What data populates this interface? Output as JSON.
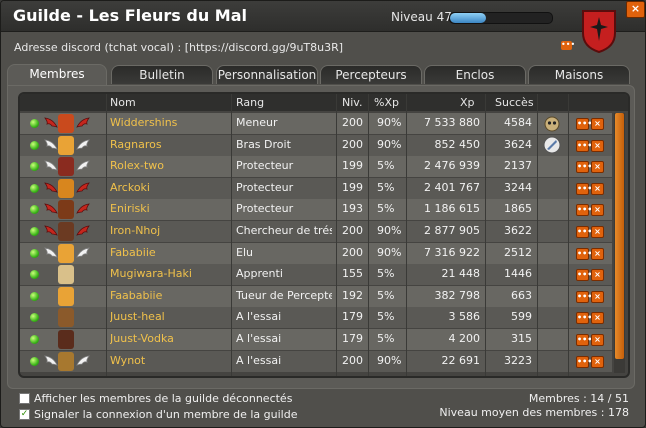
{
  "window": {
    "title": "Guilde - Les Fleurs du Mal",
    "level_label": "Niveau 47",
    "level_progress": 0.35,
    "close": "×"
  },
  "discord": {
    "text": "Adresse discord (tchat vocal) : [https://discord.gg/9uT8u3R]",
    "btn": "•••"
  },
  "tabs": [
    "Membres",
    "Bulletin",
    "Personnalisation",
    "Percepteurs",
    "Enclos",
    "Maisons"
  ],
  "columns": {
    "nom": "Nom",
    "rang": "Rang",
    "niv": "Niv.",
    "xpp": "%Xp",
    "xp": "Xp",
    "succes": "Succès"
  },
  "members": [
    {
      "nom": "Widdershins",
      "rang": "Meneur",
      "niv": "200",
      "xpp": "90%",
      "xp": "7 533 880",
      "succes": "4584",
      "wing": "red",
      "avatar": "#c94a1d"
    },
    {
      "nom": "Ragnaros",
      "rang": "Bras Droit",
      "niv": "200",
      "xpp": "90%",
      "xp": "852 450",
      "succes": "3624",
      "wing": "white",
      "avatar": "#e9a336"
    },
    {
      "nom": "Rolex-two",
      "rang": "Protecteur",
      "niv": "199",
      "xpp": "5%",
      "xp": "2 476 939",
      "succes": "2137",
      "wing": "white",
      "avatar": "#8a2b1f"
    },
    {
      "nom": "Arckoki",
      "rang": "Protecteur",
      "niv": "199",
      "xpp": "5%",
      "xp": "2 401 767",
      "succes": "3244",
      "wing": "red",
      "avatar": "#d8861e"
    },
    {
      "nom": "Eniriski",
      "rang": "Protecteur",
      "niv": "193",
      "xpp": "5%",
      "xp": "1 186 615",
      "succes": "1865",
      "wing": "red",
      "avatar": "#7c3a18"
    },
    {
      "nom": "Iron-Nhoj",
      "rang": "Chercheur de trésors",
      "niv": "200",
      "xpp": "90%",
      "xp": "2 877 905",
      "succes": "3622",
      "wing": "red",
      "avatar": "#6b3a22"
    },
    {
      "nom": "Fababiie",
      "rang": "Elu",
      "niv": "200",
      "xpp": "90%",
      "xp": "7 316 922",
      "succes": "2512",
      "wing": "white",
      "avatar": "#e9a336"
    },
    {
      "nom": "Mugiwara-Haki",
      "rang": "Apprenti",
      "niv": "155",
      "xpp": "5%",
      "xp": "21 448",
      "succes": "1446",
      "wing": "none",
      "avatar": "#d9c08a"
    },
    {
      "nom": "Faababiie",
      "rang": "Tueur de Percepteurs",
      "niv": "192",
      "xpp": "5%",
      "xp": "382 798",
      "succes": "663",
      "wing": "none",
      "avatar": "#e9a336"
    },
    {
      "nom": "Juust-heal",
      "rang": "A l'essai",
      "niv": "179",
      "xpp": "5%",
      "xp": "3 586",
      "succes": "599",
      "wing": "none",
      "avatar": "#8b5a2b"
    },
    {
      "nom": "Juust-Vodka",
      "rang": "A l'essai",
      "niv": "179",
      "xpp": "5%",
      "xp": "4 200",
      "succes": "315",
      "wing": "none",
      "avatar": "#5a2c1c"
    },
    {
      "nom": "Wynot",
      "rang": "A l'essai",
      "niv": "200",
      "xpp": "90%",
      "xp": "22 691",
      "succes": "3223",
      "wing": "white",
      "avatar": "#a7782f"
    }
  ],
  "options": {
    "show_offline": "Afficher les membres de la guilde déconnectés",
    "notify": "Signaler la connexion d'un membre de la guilde"
  },
  "stats": {
    "members": "Membres : 14 / 51",
    "avg_level": "Niveau moyen des membres : 178"
  },
  "colors": {
    "accent": "#e0620c",
    "name": "#f0c14b",
    "online": "#3bb519"
  }
}
